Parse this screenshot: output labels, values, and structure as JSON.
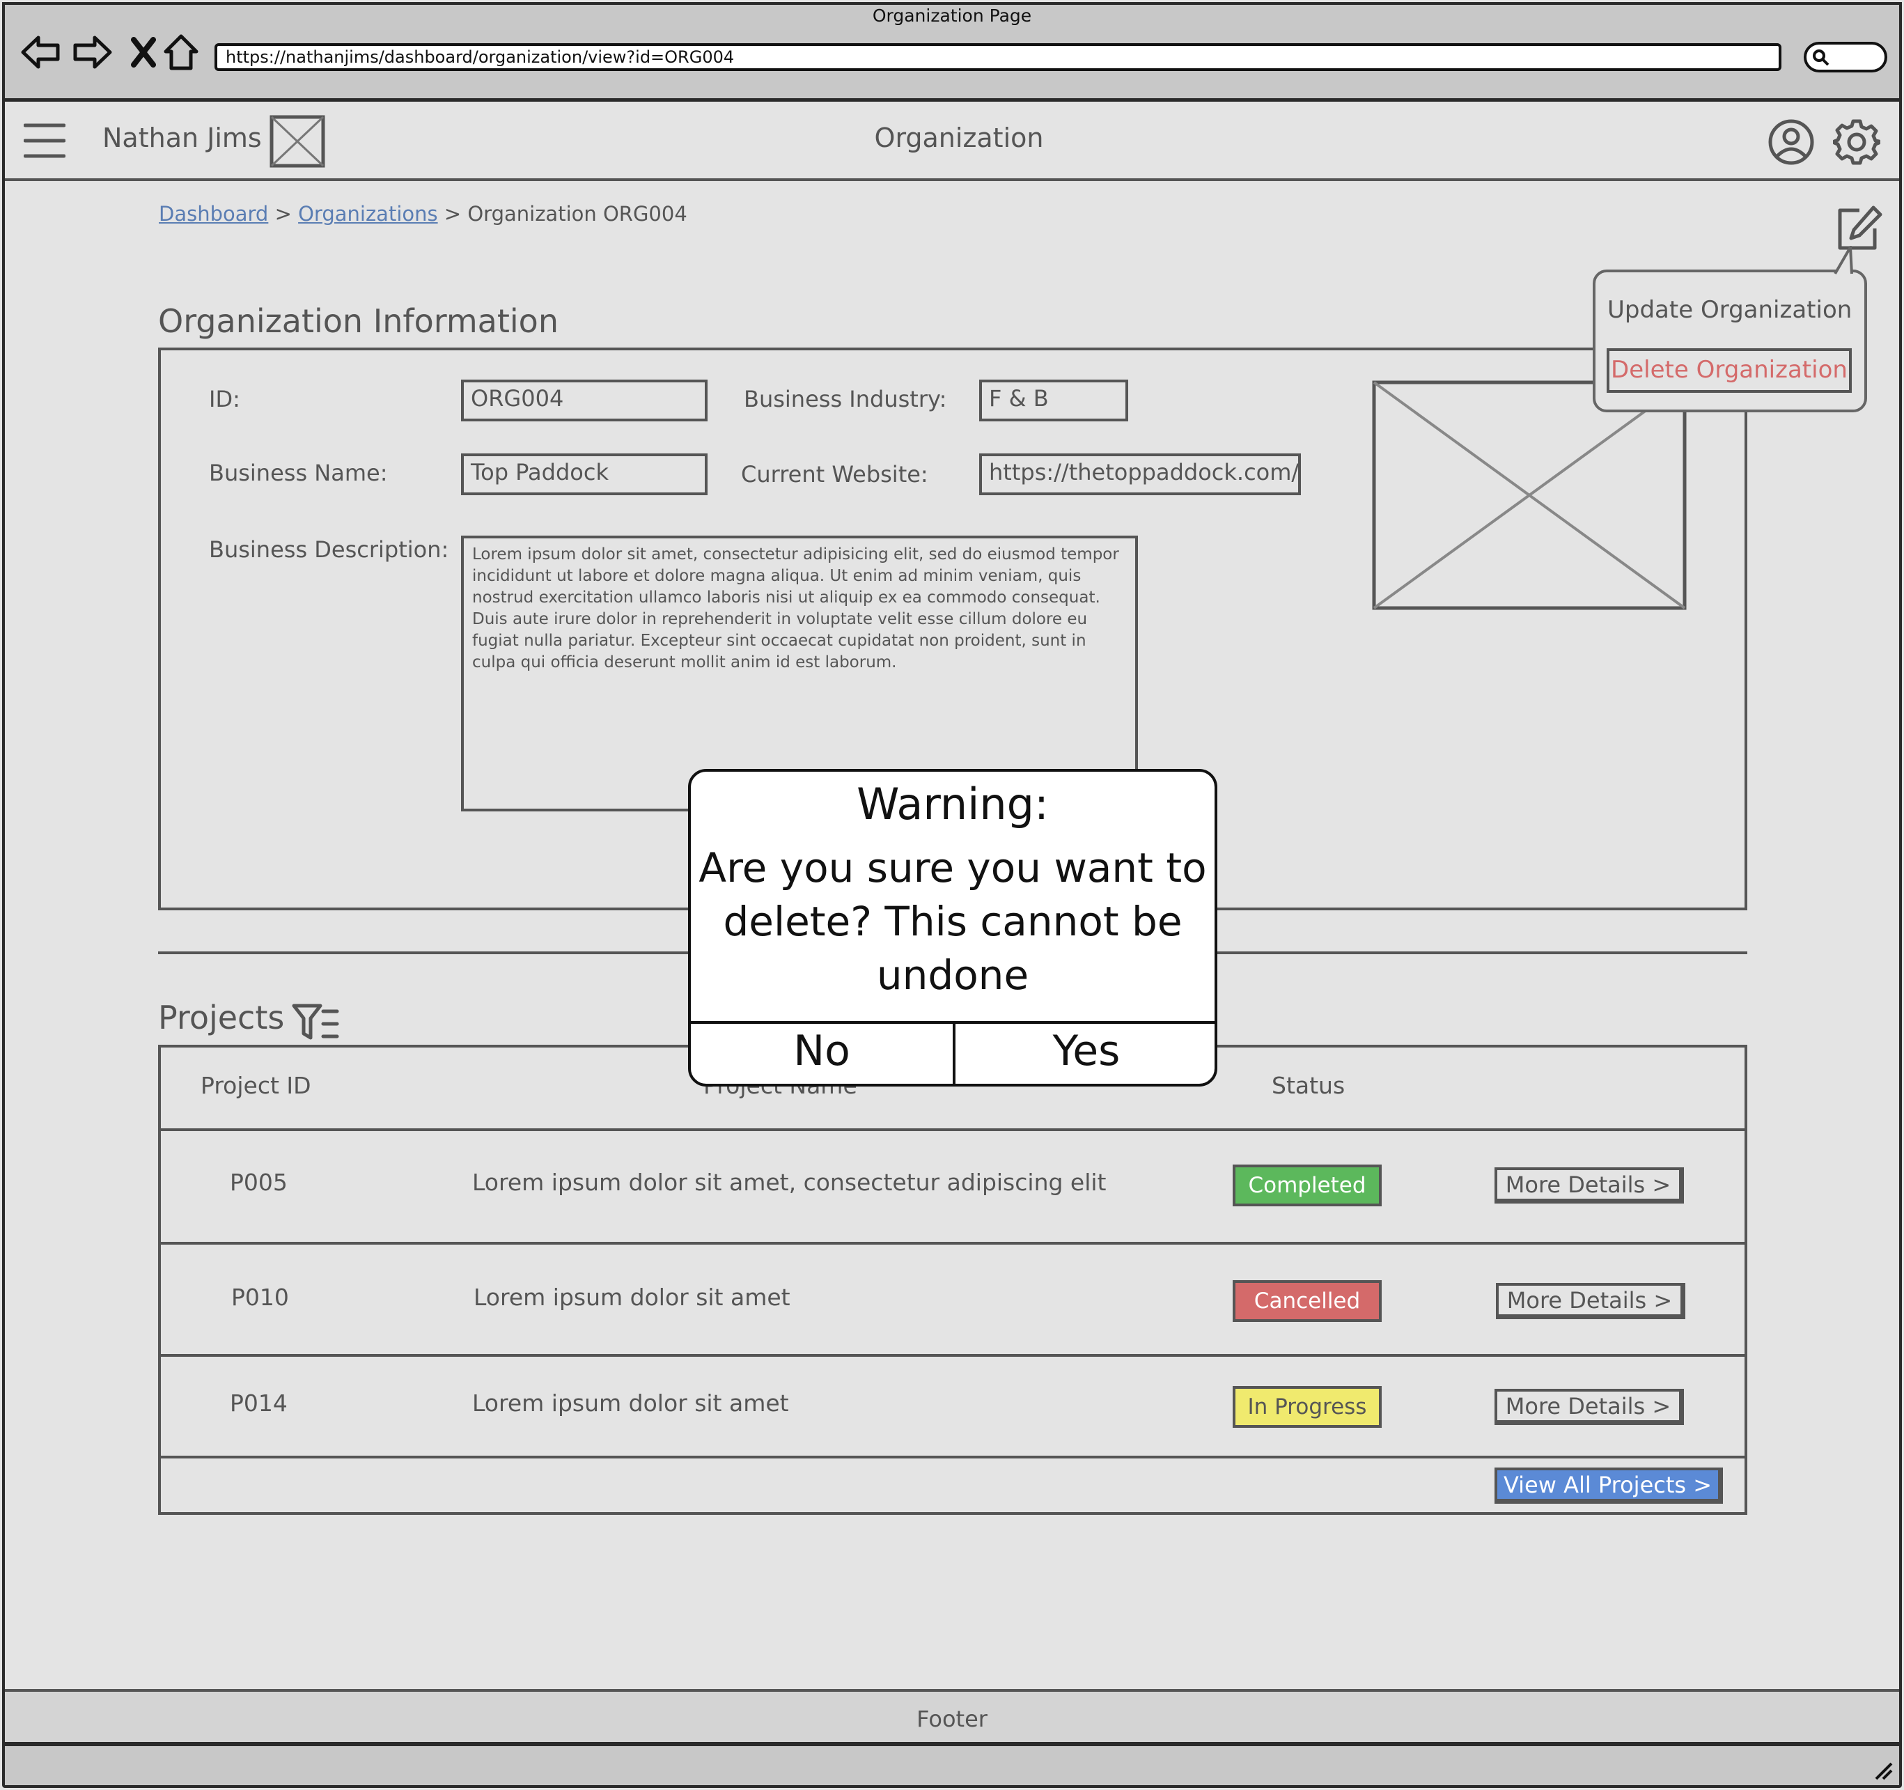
{
  "browser": {
    "window_title": "Organization Page",
    "url": "https://nathanjims/dashboard/organization/view?id=ORG004"
  },
  "header": {
    "user_name": "Nathan Jims",
    "title": "Organization"
  },
  "breadcrumb": {
    "items": [
      "Dashboard",
      "Organizations"
    ],
    "separator": ">",
    "current": "Organization ORG004"
  },
  "org_info": {
    "section_title": "Organization Information",
    "id_label": "ID:",
    "id_value": "ORG004",
    "industry_label": "Business Industry:",
    "industry_value": "F & B",
    "name_label": "Business Name:",
    "name_value": "Top Paddock",
    "website_label": "Current Website:",
    "website_value": "https://thetoppaddock.com/",
    "desc_label": "Business Description:",
    "desc_value": "Lorem ipsum dolor sit amet, consectetur adipisicing elit, sed do eiusmod tempor incididunt ut labore et dolore magna aliqua. Ut enim ad minim veniam, quis nostrud exercitation ullamco laboris nisi ut aliquip ex ea commodo consequat. Duis aute irure dolor in reprehenderit in voluptate velit esse cillum dolore eu fugiat nulla pariatur. Excepteur sint occaecat cupidatat non proident, sunt in culpa qui officia deserunt mollit anim id est laborum."
  },
  "edit_menu": {
    "update_label": "Update Organization",
    "delete_label": "Delete Organization"
  },
  "projects": {
    "section_title": "Projects",
    "columns": [
      "Project ID",
      "Project Name",
      "Status"
    ],
    "rows": [
      {
        "id": "P005",
        "name": "Lorem ipsum dolor sit amet, consectetur adipiscing elit",
        "status": "Completed",
        "status_color": "#5cb85c",
        "action": "More Details >"
      },
      {
        "id": "P010",
        "name": "Lorem ipsum dolor sit amet",
        "status": "Cancelled",
        "status_color": "#d46a6a",
        "action": "More Details >"
      },
      {
        "id": "P014",
        "name": "Lorem ipsum dolor sit amet",
        "status": "In Progress",
        "status_color": "#f0ea6e",
        "action": "More Details >"
      }
    ],
    "view_all_label": "View All Projects >"
  },
  "modal": {
    "title": "Warning:",
    "message": "Are you sure you want to delete? This cannot be undone",
    "no_label": "No",
    "yes_label": "Yes"
  },
  "footer": {
    "text": "Footer"
  },
  "icons": {
    "back": "arrow-left-icon",
    "forward": "arrow-right-icon",
    "stop": "close-icon",
    "home": "home-icon",
    "search": "search-icon",
    "menu": "hamburger-menu-icon",
    "logo": "image-placeholder-icon",
    "account": "user-circle-icon",
    "settings": "gear-icon",
    "edit": "pencil-square-icon",
    "filter": "filter-list-icon",
    "resize": "resize-grip-icon"
  }
}
